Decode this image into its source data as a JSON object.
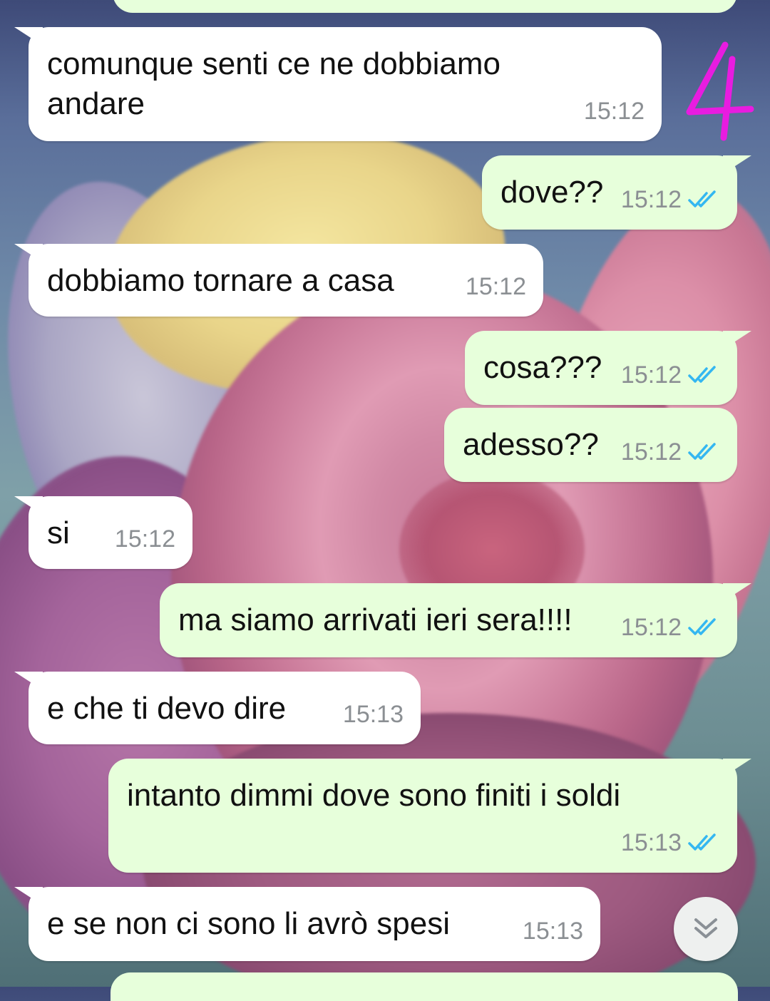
{
  "annotation": {
    "number": "4",
    "color": "#e81ce0"
  },
  "messages": [
    {
      "direction": "incoming",
      "text": "comunque senti ce ne dobbiamo\nandare",
      "time": "15:12"
    },
    {
      "direction": "outgoing",
      "text": "dove??",
      "time": "15:12",
      "status_icon": "double-check-read"
    },
    {
      "direction": "incoming",
      "text": "dobbiamo tornare a casa",
      "time": "15:12"
    },
    {
      "direction": "outgoing",
      "text": "cosa???",
      "time": "15:12",
      "status_icon": "double-check-read"
    },
    {
      "direction": "outgoing",
      "text": "adesso??",
      "time": "15:12",
      "status_icon": "double-check-read"
    },
    {
      "direction": "incoming",
      "text": "si",
      "time": "15:12"
    },
    {
      "direction": "outgoing",
      "text": "ma siamo arrivati ieri sera!!!!",
      "time": "15:12",
      "status_icon": "double-check-read"
    },
    {
      "direction": "incoming",
      "text": "e che ti devo dire",
      "time": "15:13"
    },
    {
      "direction": "outgoing",
      "text": "intanto dimmi dove sono finiti i soldi",
      "time": "15:13",
      "status_icon": "double-check-read"
    },
    {
      "direction": "incoming",
      "text": "e se non ci sono li avrò spesi",
      "time": "15:13"
    }
  ],
  "colors": {
    "incoming_bubble": "#ffffff",
    "outgoing_bubble": "#e7ffdb",
    "read_tick": "#34b7f1",
    "timestamp": "#8b8f93"
  },
  "scroll_button_icon": "chevron-double-down-icon"
}
